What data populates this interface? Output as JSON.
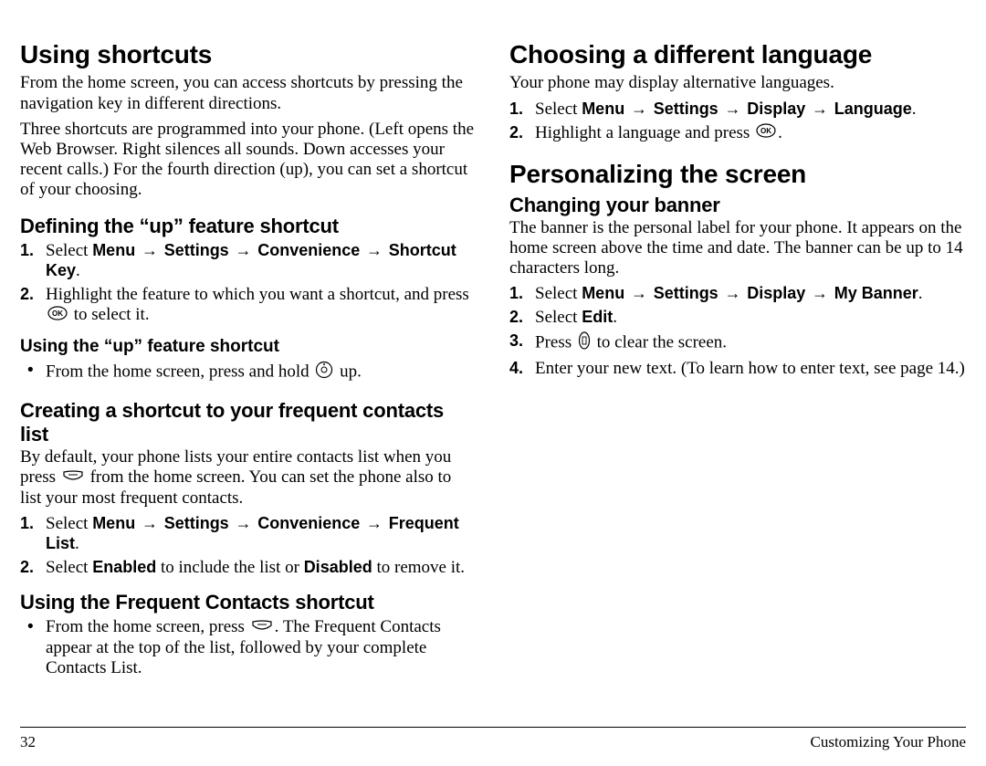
{
  "col1": {
    "h1": "Using shortcuts",
    "intro1": "From the home screen, you can access shortcuts by pressing the navigation key in different directions.",
    "intro2": "Three shortcuts are programmed into your phone. (Left opens the Web Browser. Right silences all sounds. Down accesses your recent calls.) For the fourth direction (up), you can set a shortcut of your choosing.",
    "h2a": "Defining the “up” feature shortcut",
    "s1_pre": "Select ",
    "s1_m": "Menu",
    "s1_a": "Settings",
    "s1_b": "Convenience",
    "s1_c": "Shortcut Key",
    "s1_post": ".",
    "s2a": "Highlight the feature to which you want a shortcut, and press ",
    "s2b": " to select it.",
    "h3a": "Using the “up” feature shortcut",
    "u1a": "From the home screen, press and hold ",
    "u1b": " up.",
    "h2b": "Creating a shortcut to your frequent contacts list",
    "p_freq_a": "By default, your phone lists your entire contacts list when you press ",
    "p_freq_b": " from the home screen. You can set the phone also to list your most frequent contacts.",
    "f1_pre": "Select ",
    "f1_m": "Menu",
    "f1_a": "Settings",
    "f1_b": "Convenience",
    "f1_c": "Frequent List",
    "f1_post": "."
  },
  "col2": {
    "c2_s2a": "Select ",
    "c2_s2b": "Enabled",
    "c2_s2c": " to include the list or ",
    "c2_s2d": "Disabled",
    "c2_s2e": " to remove it.",
    "h2c": "Using the Frequent Contacts shortcut",
    "fc1a": "From the home screen, press ",
    "fc1b": ". The Frequent Contacts appear at the top of the list, followed by your complete Contacts List.",
    "h1b": "Choosing a different language",
    "lang_intro": "Your phone may display alternative languages.",
    "l1_pre": "Select ",
    "l1_m": "Menu",
    "l1_a": "Settings",
    "l1_b": "Display",
    "l1_c": "Language",
    "l1_post": ".",
    "l2a": "Highlight a language and press ",
    "l2b": ".",
    "h1c": "Personalizing the screen",
    "h2d": "Changing your banner",
    "banner_intro": "The banner is the personal label for your phone. It appears on the home screen above the time and date. The banner can be up to 14 characters long.",
    "b1_pre": "Select ",
    "b1_m": "Menu",
    "b1_a": "Settings",
    "b1_b": "Display",
    "b1_c": "My Banner",
    "b1_post": ".",
    "b2a": "Select ",
    "b2b": "Edit",
    "b2c": ".",
    "b3a": "Press ",
    "b3b": " to clear the screen.",
    "b4": "Enter your new text. (To learn how to enter text, see page 14.)"
  },
  "footer": {
    "page": "32",
    "section": "Customizing Your Phone"
  },
  "arrow": "→"
}
